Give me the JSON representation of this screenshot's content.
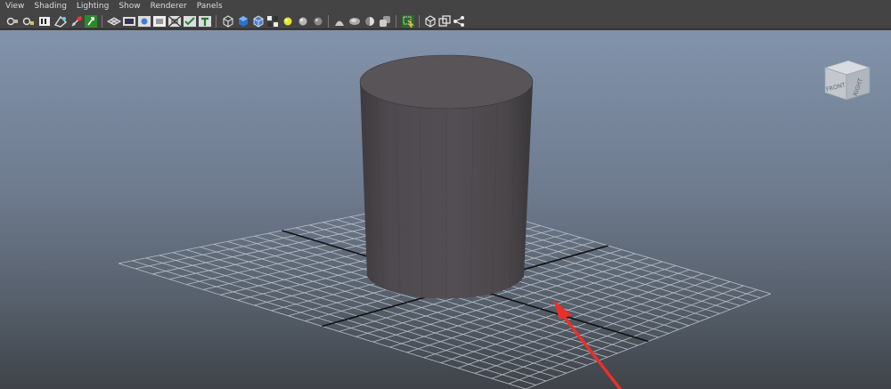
{
  "menu": {
    "items": [
      "View",
      "Shading",
      "Lighting",
      "Show",
      "Renderer",
      "Panels"
    ]
  },
  "toolbar": {
    "buttons": [
      "select-camera-icon",
      "lock-camera-icon",
      "camera-attributes-icon",
      "bookmarks-icon",
      "image-plane-icon",
      "two-d-pan-zoom-icon",
      "grid-icon",
      "film-gate-icon",
      "resolution-gate-icon",
      "gate-mask-icon",
      "field-chart-icon",
      "safe-title-icon",
      "wireframe-icon",
      "smooth-shade-icon",
      "default-material-icon",
      "textured-icon",
      "use-all-lights-icon",
      "shadows-icon",
      "screen-space-ao-icon",
      "motion-blur-icon",
      "anti-aliasing-icon",
      "depth-of-field-icon",
      "xray-icon",
      "isolate-select-icon",
      "xray-joints-icon",
      "xray-active-components-icon",
      "backface-culling-icon"
    ]
  },
  "viewcube": {
    "front_label": "FRONT",
    "right_label": "RIGHT"
  },
  "colors": {
    "viewport_top": "#8193ab",
    "viewport_bottom": "#3f4349",
    "grid_line": "#b9bfc7",
    "grid_axis": "#111111",
    "cylinder_side": "#4e4a4e",
    "cylinder_top": "#595458",
    "annotation_arrow": "#e8302a"
  }
}
